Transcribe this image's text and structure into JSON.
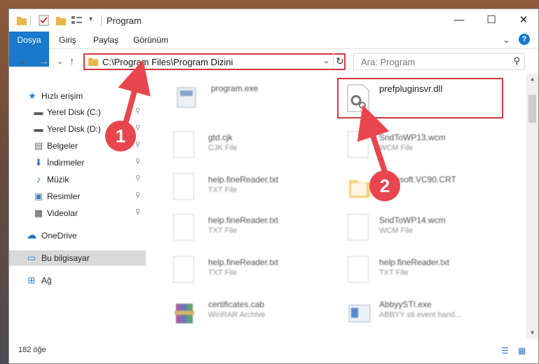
{
  "window": {
    "title": "Program",
    "controls": {
      "minimize": "—",
      "maximize": "☐",
      "close": "✕"
    }
  },
  "ribbon": {
    "tabs": [
      "Dosya",
      "Giriş",
      "Paylaş",
      "Görünüm"
    ],
    "expand": "⌄",
    "help": "?"
  },
  "nav": {
    "back": "←",
    "forward": "→",
    "recent": "⌄",
    "up": "↑",
    "path": "C:\\Program Files\\Program Dizini",
    "refresh": "↻",
    "search_placeholder": "Ara: Program"
  },
  "sidebar": {
    "items": [
      {
        "label": "Hızlı erişim",
        "icon": "star-icon",
        "glyph": "★",
        "color": "#2b7cd3",
        "pinned": false
      },
      {
        "label": "Yerel Disk (C:)",
        "icon": "drive-icon",
        "glyph": "▬",
        "color": "#5a5a5a",
        "pinned": true
      },
      {
        "label": "Yerel Disk (D:)",
        "icon": "drive-icon",
        "glyph": "▬",
        "color": "#5a5a5a",
        "pinned": true
      },
      {
        "label": "Belgeler",
        "icon": "documents-icon",
        "glyph": "▤",
        "color": "#6b6b6b",
        "pinned": true
      },
      {
        "label": "İndirmeler",
        "icon": "download-icon",
        "glyph": "⬇",
        "color": "#2b7cd3",
        "pinned": true
      },
      {
        "label": "Müzik",
        "icon": "music-icon",
        "glyph": "♪",
        "color": "#2b7cd3",
        "pinned": true
      },
      {
        "label": "Resimler",
        "icon": "pictures-icon",
        "glyph": "▣",
        "color": "#4a7fb5",
        "pinned": true
      },
      {
        "label": "Videolar",
        "icon": "video-icon",
        "glyph": "▦",
        "color": "#4a4a4a",
        "pinned": true
      },
      {
        "label": "OneDrive",
        "icon": "cloud-icon",
        "glyph": "☁",
        "color": "#1b6fc7",
        "pinned": false
      },
      {
        "label": "Bu bilgisayar",
        "icon": "computer-icon",
        "glyph": "▭",
        "color": "#2b7cd3",
        "pinned": false
      },
      {
        "label": "Ağ",
        "icon": "network-icon",
        "glyph": "⊞",
        "color": "#2b7cd3",
        "pinned": false
      }
    ],
    "pin_glyph": "📌"
  },
  "files": [
    {
      "name": "program.exe",
      "type": "",
      "icon": "exe-icon"
    },
    {
      "name": "prefpluginsvr.dll",
      "type": "",
      "icon": "dll-gear-icon"
    },
    {
      "name": "gtd.cjk",
      "type": "CJK File",
      "icon": "file-icon"
    },
    {
      "name": "SndToWP13.wcm",
      "type": "WCM File",
      "icon": "file-icon"
    },
    {
      "name": "help.fineReader.txt",
      "type": "TXT File",
      "icon": "file-icon"
    },
    {
      "name": "Microsoft.VC90.CRT",
      "type": "",
      "icon": "folder-icon"
    },
    {
      "name": "help.fineReader.txt",
      "type": "TXT File",
      "icon": "file-icon"
    },
    {
      "name": "SndToWP14.wcm",
      "type": "WCM File",
      "icon": "file-icon"
    },
    {
      "name": "help.fineReader.txt",
      "type": "TXT File",
      "icon": "file-icon"
    },
    {
      "name": "help.fineReader.txt",
      "type": "TXT File",
      "icon": "file-icon"
    },
    {
      "name": "certificates.cab",
      "type": "WinRAR Archive",
      "icon": "archive-icon"
    },
    {
      "name": "AbbyySTI.exe",
      "type": "ABBYY sti event hand...",
      "icon": "exe-icon"
    }
  ],
  "status": {
    "count": "182 öğe",
    "views": [
      "☰",
      "▦"
    ]
  },
  "callouts": [
    "1",
    "2"
  ],
  "colors": {
    "accent": "#1979ca",
    "highlight": "#d9363e",
    "callout": "#e8464e"
  }
}
